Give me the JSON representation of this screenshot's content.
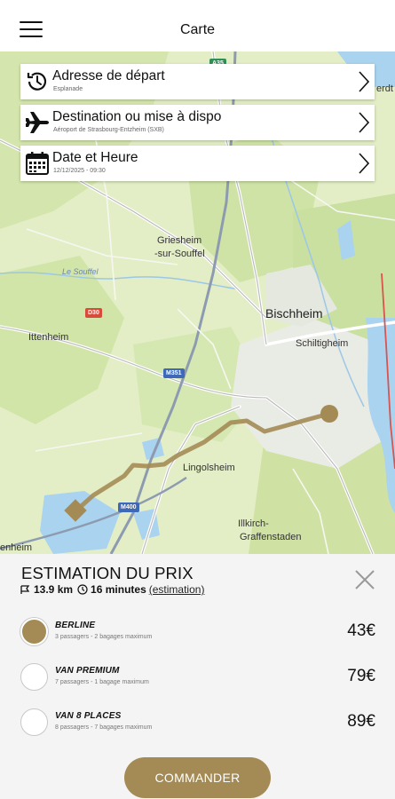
{
  "header": {
    "title": "Carte",
    "menu_icon": "hamburger-menu-icon"
  },
  "map": {
    "labels": {
      "griesheim_1": "Griesheim",
      "griesheim_2": "-sur-Souffel",
      "bischheim": "Bischheim",
      "schiltigheim": "Schiltigheim",
      "ittenheim": "Ittenheim",
      "lingolsheim": "Lingolsheim",
      "illkirch_1": "Illkirch-",
      "illkirch_2": "Graffenstaden",
      "souffel": "Le Souffel",
      "edge_right": "erdt",
      "edge_left": "enheim"
    },
    "shields": {
      "a35_top": "A35",
      "d30": "D30",
      "m351": "M351",
      "m400": "M400"
    },
    "route_color": "#a48b55"
  },
  "cards": {
    "departure": {
      "title": "Adresse de départ",
      "subtitle": "Esplanade",
      "icon": "history-clock-icon"
    },
    "destination": {
      "title": "Destination ou mise à dispo",
      "subtitle": "Aéroport de Strasbourg-Entzheim (SXB)",
      "icon": "airplane-icon"
    },
    "datetime": {
      "title": "Date et Heure",
      "subtitle": "12/12/2025 - 09:30",
      "icon": "calendar-icon"
    }
  },
  "estimate": {
    "title": "ESTIMATION DU PRIX",
    "distance": "13.9 km",
    "duration": "16 minutes",
    "link": "(estimation)",
    "options": [
      {
        "name": "BERLINE",
        "details": "3 passagers - 2 bagages maximum",
        "price": "43€",
        "selected": true
      },
      {
        "name": "VAN PREMIUM",
        "details": "7 passagers - 1 bagage maximum",
        "price": "79€",
        "selected": false
      },
      {
        "name": "VAN 8 PLACES",
        "details": "8 passagers - 7 bagages maximum",
        "price": "89€",
        "selected": false
      }
    ],
    "order_label": "COMMANDER"
  },
  "colors": {
    "accent": "#a48b55",
    "map_green": "#cfe3a6",
    "map_water": "#a9d3ef",
    "road": "#ffffff"
  }
}
